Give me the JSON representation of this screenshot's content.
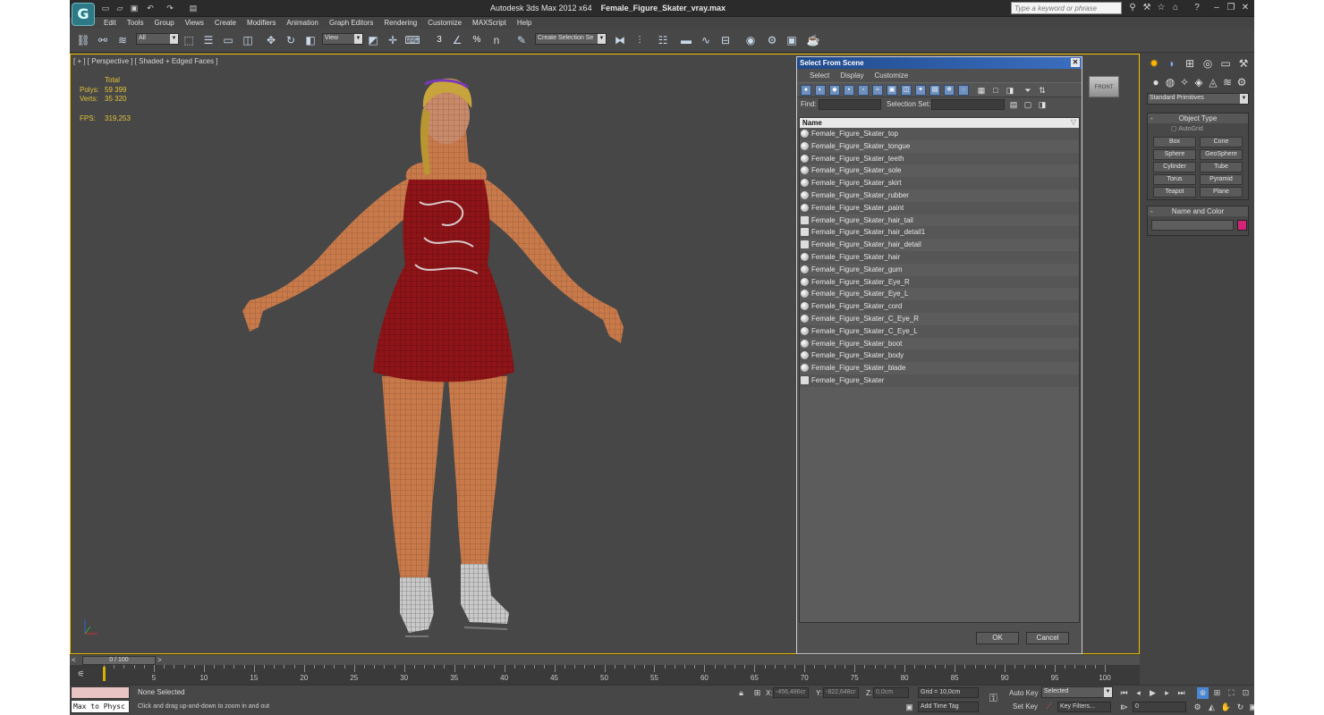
{
  "app": {
    "title": "Autodesk 3ds Max  2012 x64",
    "file": "Female_Figure_Skater_vray.max",
    "logo_glyph": "G",
    "search_placeholder": "Type a keyword or phrase"
  },
  "menu": [
    "Edit",
    "Tools",
    "Group",
    "Views",
    "Create",
    "Modifiers",
    "Animation",
    "Graph Editors",
    "Rendering",
    "Customize",
    "MAXScript",
    "Help"
  ],
  "toolbar": {
    "filter_value": "All",
    "refcoord_value": "View",
    "selection_set_value": "Create Selection Se",
    "snap_3": "3",
    "snap_percent": "%",
    "snap_angle": "n"
  },
  "viewport": {
    "label": "[ + ] [ Perspective ] [ Shaded + Edged Faces ]",
    "stats": {
      "total_label": "Total",
      "polys_label": "Polys:",
      "polys_value": "59 399",
      "verts_label": "Verts:",
      "verts_value": "35 320",
      "fps_label": "FPS:",
      "fps_value": "319,253"
    },
    "viewcube_label": "FRONT"
  },
  "dialog": {
    "title": "Select From Scene",
    "menu": [
      "Select",
      "Display",
      "Customize"
    ],
    "find_label": "Find:",
    "find_value": "",
    "selection_set_label": "Selection Set:",
    "list_header": "Name",
    "items": [
      {
        "name": "Female_Figure_Skater_top",
        "icon": "sphere"
      },
      {
        "name": "Female_Figure_Skater_tongue",
        "icon": "sphere"
      },
      {
        "name": "Female_Figure_Skater_teeth",
        "icon": "sphere"
      },
      {
        "name": "Female_Figure_Skater_sole",
        "icon": "sphere"
      },
      {
        "name": "Female_Figure_Skater_skirt",
        "icon": "sphere"
      },
      {
        "name": "Female_Figure_Skater_rubber",
        "icon": "sphere"
      },
      {
        "name": "Female_Figure_Skater_paint",
        "icon": "sphere"
      },
      {
        "name": "Female_Figure_Skater_hair_tail",
        "icon": "group"
      },
      {
        "name": "Female_Figure_Skater_hair_detail1",
        "icon": "group"
      },
      {
        "name": "Female_Figure_Skater_hair_detail",
        "icon": "group"
      },
      {
        "name": "Female_Figure_Skater_hair",
        "icon": "sphere"
      },
      {
        "name": "Female_Figure_Skater_gum",
        "icon": "sphere"
      },
      {
        "name": "Female_Figure_Skater_Eye_R",
        "icon": "sphere"
      },
      {
        "name": "Female_Figure_Skater_Eye_L",
        "icon": "sphere"
      },
      {
        "name": "Female_Figure_Skater_cord",
        "icon": "sphere"
      },
      {
        "name": "Female_Figure_Skater_C_Eye_R",
        "icon": "sphere"
      },
      {
        "name": "Female_Figure_Skater_C_Eye_L",
        "icon": "sphere"
      },
      {
        "name": "Female_Figure_Skater_boot",
        "icon": "sphere"
      },
      {
        "name": "Female_Figure_Skater_body",
        "icon": "sphere"
      },
      {
        "name": "Female_Figure_Skater_blade",
        "icon": "sphere"
      },
      {
        "name": "Female_Figure_Skater",
        "icon": "group"
      }
    ],
    "ok_label": "OK",
    "cancel_label": "Cancel"
  },
  "command_panel": {
    "dropdown_value": "Standard Primitives",
    "object_type_title": "Object Type",
    "autogrid_label": "AutoGrid",
    "primitives": [
      "Box",
      "Cone",
      "Sphere",
      "GeoSphere",
      "Cylinder",
      "Tube",
      "Torus",
      "Pyramid",
      "Teapot",
      "Plane"
    ],
    "name_color_title": "Name and Color",
    "object_color": "#d4247a"
  },
  "timeline": {
    "frame_label": "0 / 100",
    "prev": "<",
    "next": ">",
    "ticks": [
      "0",
      "5",
      "10",
      "15",
      "20",
      "25",
      "30",
      "35",
      "40",
      "45",
      "50",
      "55",
      "60",
      "65",
      "70",
      "75",
      "80",
      "85",
      "90",
      "95",
      "100"
    ]
  },
  "status": {
    "script_listener": "Max to Physc",
    "selection": "None Selected",
    "prompt": "Click and drag up-and-down to zoom in and out",
    "x_label": "X:",
    "x_value": "-456,486cr",
    "y_label": "Y:",
    "y_value": "-822,648cr",
    "z_label": "Z:",
    "z_value": "0,0cm",
    "grid": "Grid = 10,0cm",
    "add_time_tag": "Add Time Tag",
    "auto_key": "Auto Key",
    "set_key": "Set Key",
    "selected_value": "Selected",
    "key_filters": "Key Filters...",
    "frame_value": "0"
  },
  "colors": {
    "viewport_border": "#f0c000",
    "dialog_title": "#1f4a8c",
    "skin": "#c97a4a",
    "dress": "#8e1418"
  }
}
